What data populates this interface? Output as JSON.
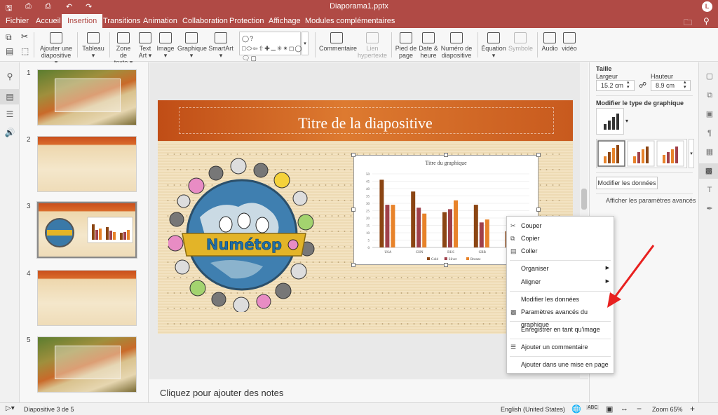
{
  "app": {
    "doc_title": "Diaporama1.pptx",
    "user_initial": "L",
    "quick_access": [
      "save-icon",
      "print-icon",
      "quick-print-icon",
      "undo-icon",
      "redo-icon"
    ]
  },
  "menu": {
    "tabs": [
      "Fichier",
      "Accueil",
      "Insertion",
      "Transitions",
      "Animation",
      "Collaboration",
      "Protection",
      "Affichage",
      "Modules complémentaires"
    ],
    "active": "Insertion"
  },
  "ribbon": {
    "add_slide_1": "Ajouter une",
    "add_slide_2": "diapositive",
    "table": "Tableau",
    "textbox_1": "Zone de",
    "textbox_2": "texte",
    "textart_1": "Text",
    "textart_2": "Art",
    "image": "Image",
    "chart": "Graphique",
    "smartart": "SmartArt",
    "comment": "Commentaire",
    "hyperlink_1": "Lien",
    "hyperlink_2": "hypertexte",
    "footer_1": "Pied de",
    "footer_2": "page",
    "datetime_1": "Date &",
    "datetime_2": "heure",
    "slide_number_1": "Numéro de",
    "slide_number_2": "diapositive",
    "equation": "Équation",
    "symbol": "Symbole",
    "audio": "Audio",
    "video": "vidéo"
  },
  "slides": {
    "numbers": [
      "1",
      "2",
      "3",
      "4",
      "5"
    ],
    "selected": "3"
  },
  "slide": {
    "title": "Titre de la diapositive",
    "logo_text": "Numétop"
  },
  "chart_data": {
    "type": "bar",
    "title": "Titre du graphique",
    "categories": [
      "USA",
      "CHN",
      "RUS",
      "GBR",
      "GER"
    ],
    "series": [
      {
        "name": "Gold",
        "values": [
          46,
          38,
          24,
          29,
          11
        ]
      },
      {
        "name": "Silver",
        "values": [
          29,
          27,
          26,
          17,
          19
        ]
      },
      {
        "name": "Bronze",
        "values": [
          29,
          23,
          32,
          19,
          14
        ]
      }
    ],
    "yticks": [
      "0",
      "5",
      "10",
      "15",
      "20",
      "25",
      "30",
      "35",
      "40",
      "45",
      "50"
    ],
    "ylim": [
      0,
      50
    ],
    "colors": [
      "#8b4513",
      "#a0404a",
      "#e8832a"
    ],
    "legend": "bottom",
    "grid": true
  },
  "right_panel": {
    "size_label": "Taille",
    "width_label": "Largeur",
    "height_label": "Hauteur",
    "width_value": "15.2 cm",
    "height_value": "8.9 cm",
    "chart_type_label": "Modifier le type de graphique",
    "edit_data_button": "Modifier les données",
    "advanced_link": "Afficher les paramètres avancés"
  },
  "notes": {
    "placeholder": "Cliquez pour ajouter des notes"
  },
  "status": {
    "slide_info": "Diapositive 3 de 5",
    "language": "English (United States)",
    "zoom": "Zoom 65%"
  },
  "context_menu": {
    "cut": "Couper",
    "copy": "Copier",
    "paste": "Coller",
    "arrange": "Organiser",
    "align": "Aligner",
    "edit_data": "Modifier les données",
    "chart_advanced": "Paramètres avancés du graphique",
    "save_image": "Enregistrer en tant qu'image",
    "add_comment": "Ajouter un commentaire",
    "add_to_layout": "Ajouter dans une mise en page"
  },
  "annotation": {
    "arrow_color": "#e8201f"
  }
}
